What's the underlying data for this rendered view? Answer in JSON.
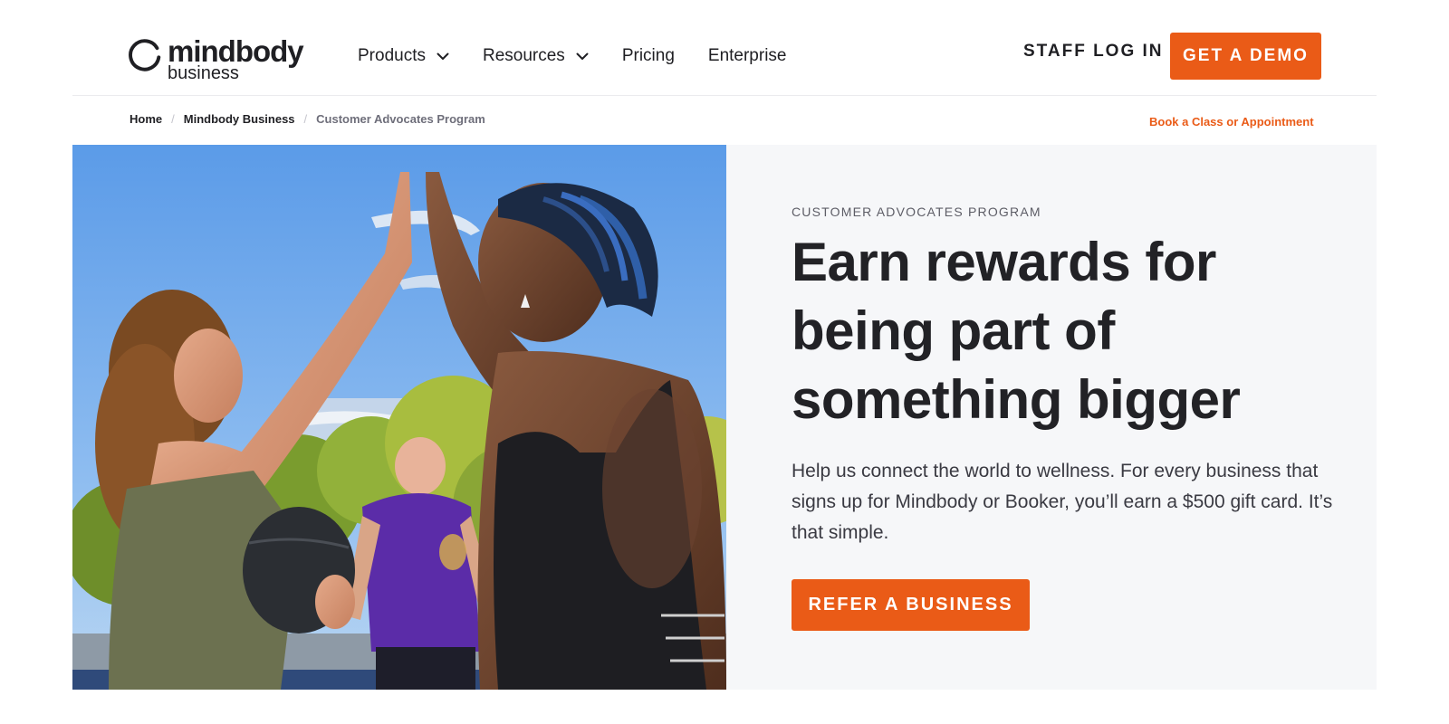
{
  "header": {
    "logo": {
      "word": "mindbody",
      "sub": "business"
    },
    "nav": [
      {
        "label": "Products",
        "has_dropdown": true
      },
      {
        "label": "Resources",
        "has_dropdown": true
      },
      {
        "label": "Pricing",
        "has_dropdown": false
      },
      {
        "label": "Enterprise",
        "has_dropdown": false
      }
    ],
    "staff_login": "STAFF LOG IN",
    "demo_button": "GET A DEMO"
  },
  "breadcrumb": {
    "items": [
      "Home",
      "Mindbody Business",
      "Customer Advocates Program"
    ],
    "separator": "/",
    "book_link": "Book a Class or Appointment"
  },
  "hero": {
    "eyebrow": "CUSTOMER ADVOCATES PROGRAM",
    "headline": "Earn rewards for being part of something bigger",
    "body": "Help us connect the world to wellness. For every business that signs up for Mindbody or Booker, you’ll earn a $500 gift card. It’s that simple.",
    "cta": "REFER A BUSINESS"
  },
  "colors": {
    "accent": "#ea5b17",
    "panel_bg": "#f6f7f9",
    "text_dark": "#1f1f23"
  },
  "icons": [
    "mindbody-logo-icon",
    "chevron-down-icon"
  ]
}
